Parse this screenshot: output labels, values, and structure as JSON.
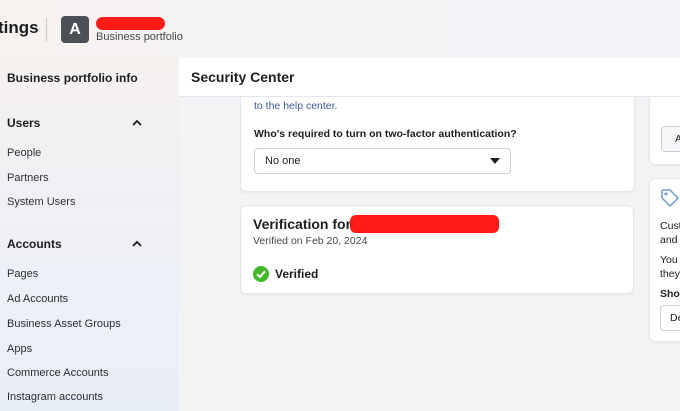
{
  "topbar": {
    "app_title": "tings",
    "avatar_letter": "A",
    "portfolio_label": "Business portfolio"
  },
  "sidebar": {
    "info_label": "Business portfolio info",
    "users_heading": "Users",
    "users_items": [
      "People",
      "Partners",
      "System Users"
    ],
    "accounts_heading": "Accounts",
    "accounts_items": [
      "Pages",
      "Ad Accounts",
      "Business Asset Groups",
      "Apps",
      "Commerce Accounts",
      "Instagram accounts"
    ]
  },
  "header": {
    "title": "Security Center"
  },
  "two_factor": {
    "help_link": "to the help center.",
    "question": "Who's required to turn on two-factor authentication?",
    "selected": "No one"
  },
  "verification": {
    "title_prefix": "Verification for",
    "date": "Verified on Feb 20, 2024",
    "status": "Verified"
  },
  "right_panel": {
    "button_partial": "A",
    "line1": "Cust",
    "line2": "and",
    "line3": "You",
    "line4": "they",
    "bold": "Sho",
    "input_partial": "De"
  },
  "colors": {
    "redaction": "#ff1a1a",
    "verified_green": "#42b72a",
    "link": "#385898"
  }
}
